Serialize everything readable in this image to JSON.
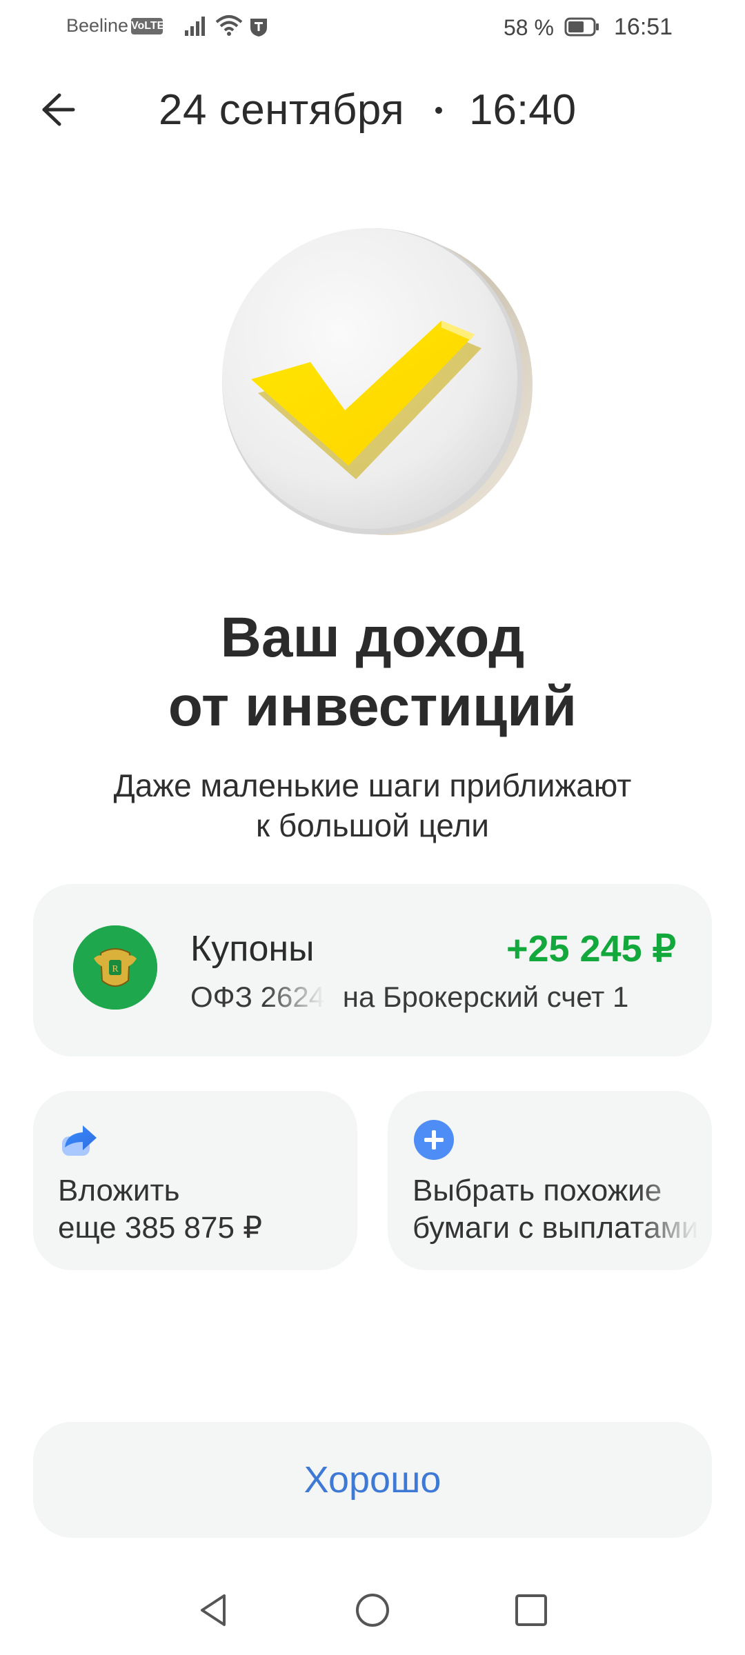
{
  "status_bar": {
    "carrier": "Beeline",
    "volte": "VoLTE",
    "battery": "58 %",
    "time": "16:51"
  },
  "header": {
    "date": "24 сентября",
    "time": "16:40"
  },
  "main": {
    "title_line1": "Ваш доход",
    "title_line2": "от инвестиций",
    "subtitle_line1": "Даже маленькие шаги приближают",
    "subtitle_line2": "к большой цели"
  },
  "coupon": {
    "title": "Купоны",
    "amount": "+25 245 ₽",
    "security": "ОФЗ 2624",
    "account": "на Брокерский счет 1",
    "amount_color": "#12a83c"
  },
  "actions": [
    {
      "line1": "Вложить",
      "line2": "еще 385 875 ₽",
      "icon": "share-arrow-icon"
    },
    {
      "line1": "Выбрать похожие",
      "line2": "бумаги с выплатами",
      "icon": "plus-circle-icon"
    }
  ],
  "ok_button": {
    "label": "Хорошо",
    "color": "#3e79d6"
  },
  "colors": {
    "accent": "#ffe000",
    "card_bg": "#f4f5f5"
  }
}
